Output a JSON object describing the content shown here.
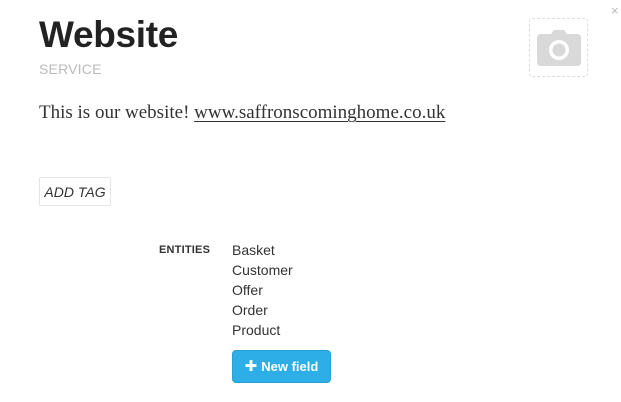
{
  "header": {
    "title": "Website",
    "subtitle": "SERVICE",
    "close_glyph": "×"
  },
  "description": {
    "text": "This is our website! ",
    "link": "www.saffronscominghome.co.uk"
  },
  "tags": {
    "add_label": "ADD TAG"
  },
  "entities": {
    "label": "ENTITIES",
    "items": [
      "Basket",
      "Customer",
      "Offer",
      "Order",
      "Product"
    ]
  },
  "actions": {
    "new_field_label": "New field",
    "new_field_glyph": "✚"
  },
  "icons": {
    "photo": "camera-icon",
    "close": "close-icon",
    "plus": "plus-icon"
  },
  "colors": {
    "accent": "#2eaee6",
    "muted": "#bbbbbb",
    "camera": "#d9d9d9"
  }
}
